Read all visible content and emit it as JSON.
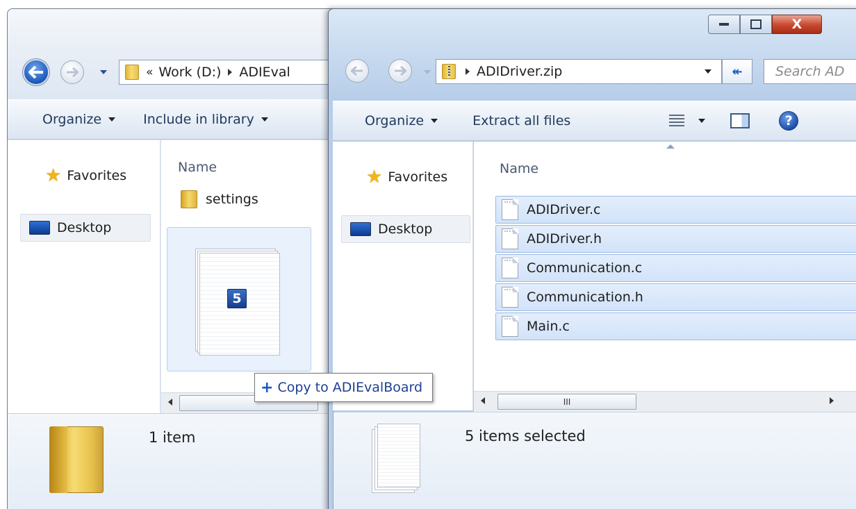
{
  "left_window": {
    "breadcrumb": {
      "overflow": "«",
      "crumb1": "Work (D:)",
      "crumb2": "ADIEval"
    },
    "toolbar": {
      "organize": "Organize",
      "include_in_library": "Include in library"
    },
    "nav": {
      "favorites": "Favorites",
      "desktop": "Desktop"
    },
    "column": {
      "name": "Name"
    },
    "items": [
      {
        "name": "settings",
        "type": "folder"
      }
    ],
    "drag_preview": {
      "count": "5"
    },
    "status": {
      "text": "1 item"
    }
  },
  "right_window": {
    "caption": {
      "minimize": "—",
      "maximize": "▢",
      "close": "X"
    },
    "breadcrumb": {
      "crumb1": "ADIDriver.zip"
    },
    "search": {
      "placeholder": "Search AD"
    },
    "toolbar": {
      "organize": "Organize",
      "extract_all": "Extract all files"
    },
    "nav": {
      "favorites": "Favorites",
      "desktop": "Desktop"
    },
    "column": {
      "name": "Name"
    },
    "files": [
      {
        "name": "ADIDriver.c",
        "selected": true
      },
      {
        "name": "ADIDriver.h",
        "selected": true
      },
      {
        "name": "Communication.c",
        "selected": true
      },
      {
        "name": "Communication.h",
        "selected": true
      },
      {
        "name": "Main.c",
        "selected": true
      }
    ],
    "scroll_thumb_grip": "III",
    "status": {
      "text": "5 items selected"
    }
  },
  "drag_tooltip": {
    "text": "Copy to ADIEvalBoard"
  },
  "colors": {
    "selection_fill": "#d2e3f9",
    "selection_border": "#9db9e3",
    "toolbar_text": "#1e395b",
    "tooltip_text": "#1c3f94"
  }
}
